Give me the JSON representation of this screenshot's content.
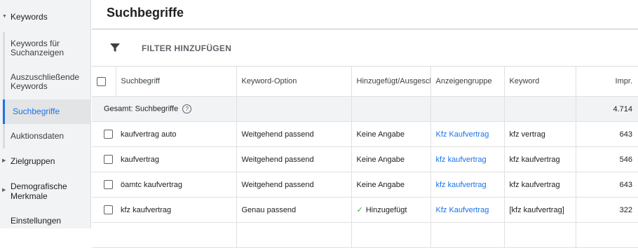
{
  "sidebar": {
    "keywords_section": "Keywords",
    "items": [
      {
        "label": "Keywords für Suchanzeigen"
      },
      {
        "label": "Auszuschließende Keywords"
      },
      {
        "label": "Suchbegriffe"
      },
      {
        "label": "Auktionsdaten"
      }
    ],
    "zielgruppen": "Zielgruppen",
    "demografische": "Demografische Merkmale",
    "einstellungen": "Einstellungen"
  },
  "page": {
    "title": "Suchbegriffe",
    "filter_label": "FILTER HINZUFÜGEN"
  },
  "table": {
    "columns": [
      "Suchbegriff",
      "Keyword-Option",
      "Hinzugefügt/Ausgeschlossen",
      "Anzeigengruppe",
      "Keyword",
      "Impr."
    ],
    "total_label": "Gesamt: Suchbegriffe",
    "total_impr": "4.714",
    "rows": [
      {
        "term": "kaufvertrag auto",
        "option": "Weitgehend passend",
        "status": "Keine Angabe",
        "adgroup": "Kfz Kaufvertrag",
        "keyword": "kfz vertrag",
        "impr": "643"
      },
      {
        "term": "kaufvertrag",
        "option": "Weitgehend passend",
        "status": "Keine Angabe",
        "adgroup": "kfz kaufvertrag",
        "keyword": "kfz kaufvertrag",
        "impr": "546"
      },
      {
        "term": "öamtc kaufvertrag",
        "option": "Weitgehend passend",
        "status": "Keine Angabe",
        "adgroup": "kfz kaufvertrag",
        "keyword": "kfz kaufvertrag",
        "impr": "643"
      },
      {
        "term": "kfz kaufvertrag",
        "option": "Genau passend",
        "status": "Hinzugefügt",
        "adgroup": "Kfz Kaufvertrag",
        "keyword": "[kfz kaufvertrag]",
        "impr": "322"
      }
    ]
  }
}
